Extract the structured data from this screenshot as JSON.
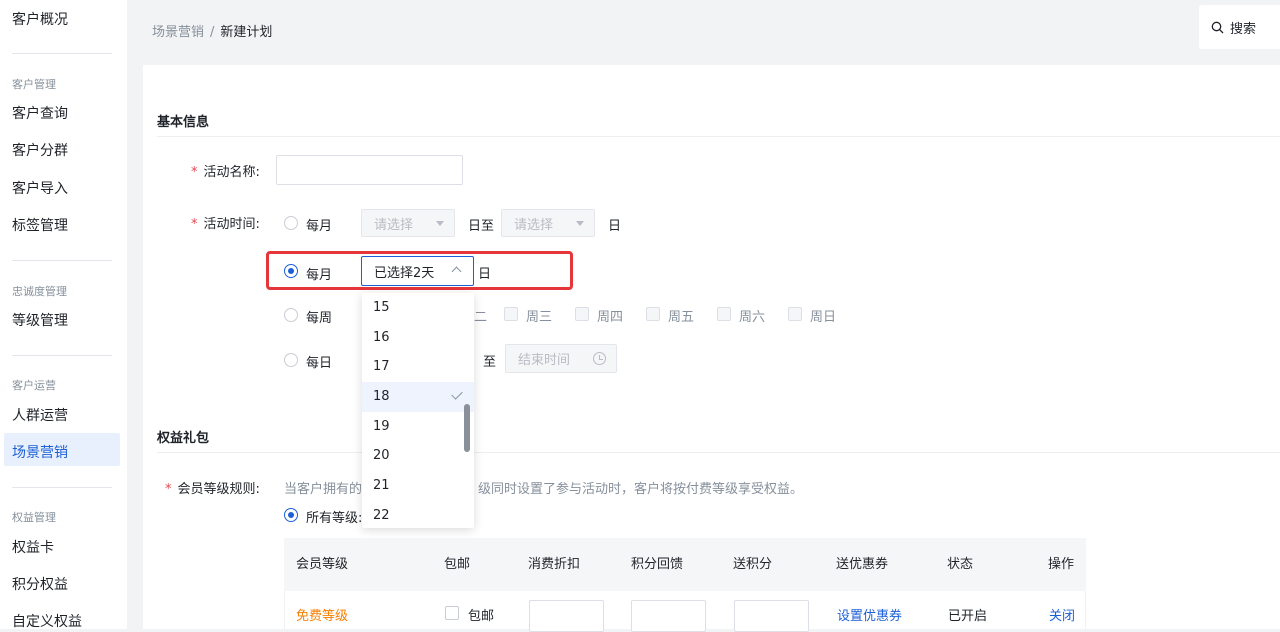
{
  "sidebar": {
    "items": [
      {
        "label": "客户概况"
      },
      {
        "group": "客户管理"
      },
      {
        "label": "客户查询"
      },
      {
        "label": "客户分群"
      },
      {
        "label": "客户导入"
      },
      {
        "label": "标签管理"
      },
      {
        "group": "忠诚度管理"
      },
      {
        "label": "等级管理"
      },
      {
        "group": "客户运营"
      },
      {
        "label": "人群运营"
      },
      {
        "label": "场景营销",
        "active": true
      },
      {
        "group": "权益管理"
      },
      {
        "label": "权益卡"
      },
      {
        "label": "积分权益"
      },
      {
        "label": "自定义权益"
      }
    ]
  },
  "header": {
    "breadcrumb": [
      "场景营销",
      "新建计划"
    ],
    "breadcrumb_sep": "/",
    "search_label": "搜索"
  },
  "basic": {
    "title": "基本信息",
    "name_label": "活动名称:",
    "time_label": "活动时间:",
    "required_mark": "*",
    "options": {
      "monthly_range": {
        "label": "每月",
        "from_placeholder": "请选择",
        "mid": "日至",
        "to_placeholder": "请选择",
        "suffix": "日"
      },
      "monthly_days": {
        "label": "每月",
        "value": "已选择2天",
        "suffix": "日"
      },
      "weekly": {
        "label": "每周",
        "days": [
          "二",
          "周三",
          "周四",
          "周五",
          "周六",
          "周日"
        ]
      },
      "daily": {
        "label": "每日",
        "to": "至",
        "end_placeholder": "结束时间"
      }
    },
    "dropdown": {
      "items": [
        "15",
        "16",
        "17",
        "18",
        "19",
        "20",
        "21",
        "22"
      ],
      "selected": "18"
    }
  },
  "benefits": {
    "title": "权益礼包",
    "rule_label": "会员等级规则:",
    "hint_left": "当客户拥有的",
    "hint_right": "级同时设置了参与活动时，客户将按付费等级享受权益。",
    "all_levels": "所有等级:",
    "table": {
      "headers": [
        "会员等级",
        "包邮",
        "消费折扣",
        "积分回馈",
        "送积分",
        "送优惠券",
        "状态",
        "操作"
      ],
      "rows": [
        {
          "level": "免费等级",
          "shipping": "包邮",
          "coupon": "设置优惠券",
          "status": "已开启",
          "action": "关闭"
        }
      ]
    }
  },
  "colors": {
    "primary": "#1d5fd6",
    "highlight": "#e5363a",
    "level": "#f77f00"
  }
}
